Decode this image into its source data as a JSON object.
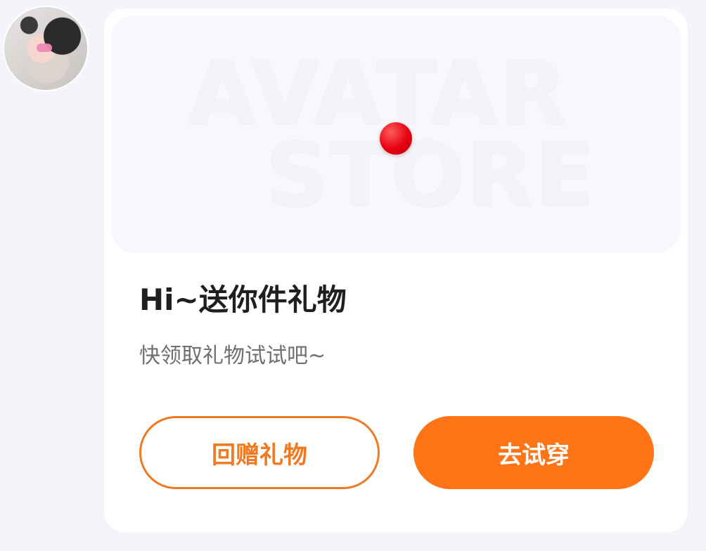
{
  "hero": {
    "word_line1": "AVATAR",
    "word_line2": "STORE"
  },
  "message": {
    "title": "Hi~送你件礼物",
    "subtitle": "快领取礼物试试吧~"
  },
  "actions": {
    "return_gift_label": "回赠礼物",
    "try_on_label": "去试穿"
  },
  "colors": {
    "accent": "#ff7417",
    "accent_outline": "#f07a22",
    "background": "#f4f5fa",
    "card": "#ffffff",
    "dot": "#e60010"
  },
  "icons": {
    "avatar": "avatar-image",
    "dot": "red-dot-icon"
  }
}
